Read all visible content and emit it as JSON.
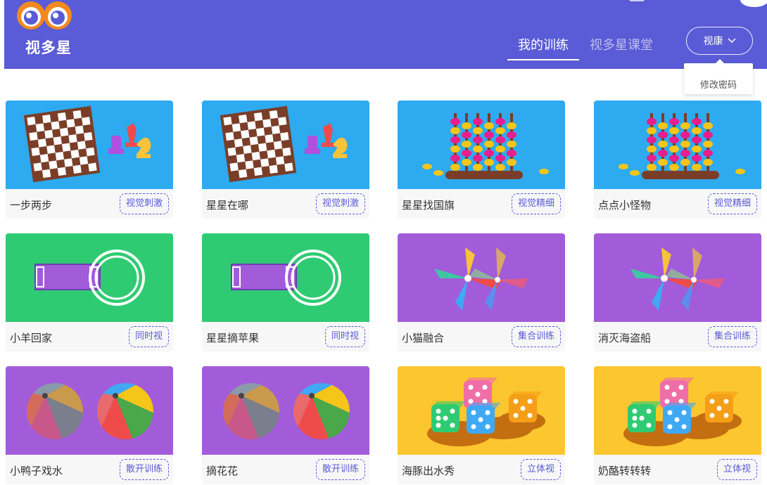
{
  "brand": {
    "name": "视多星",
    "color": "#5a5bd6"
  },
  "nav": {
    "tabs": [
      {
        "label": "我的训练",
        "active": true
      },
      {
        "label": "视多星课堂",
        "active": false
      }
    ]
  },
  "user": {
    "name": "视康",
    "menu": [
      "修改密码"
    ]
  },
  "icons": {
    "user_menu": "chevron-down-icon"
  },
  "cards": [
    {
      "title": "一步两步",
      "tag": "视觉刺激",
      "theme": "chess",
      "bg": "#2eaaf0"
    },
    {
      "title": "星星在哪",
      "tag": "视觉刺激",
      "theme": "chess",
      "bg": "#2eaaf0"
    },
    {
      "title": "星星找国旗",
      "tag": "视觉精细",
      "theme": "abacus",
      "bg": "#2eaaf0"
    },
    {
      "title": "点点小怪物",
      "tag": "视觉精细",
      "theme": "abacus",
      "bg": "#2eaaf0"
    },
    {
      "title": "小羊回家",
      "tag": "同时视",
      "theme": "tube",
      "bg": "#2fcb72"
    },
    {
      "title": "星星摘苹果",
      "tag": "同时视",
      "theme": "tube",
      "bg": "#2fcb72"
    },
    {
      "title": "小猫融合",
      "tag": "集合训练",
      "theme": "pinwheel",
      "bg": "#a25cd9"
    },
    {
      "title": "消灭海盗船",
      "tag": "集合训练",
      "theme": "pinwheel",
      "bg": "#a25cd9"
    },
    {
      "title": "小鸭子戏水",
      "tag": "散开训练",
      "theme": "balls",
      "bg": "#a25cd9"
    },
    {
      "title": "摘花花",
      "tag": "散开训练",
      "theme": "balls",
      "bg": "#a25cd9"
    },
    {
      "title": "海豚出水秀",
      "tag": "立体视",
      "theme": "dice",
      "bg": "#fcc62e"
    },
    {
      "title": "奶酪转转转",
      "tag": "立体视",
      "theme": "dice",
      "bg": "#fcc62e"
    }
  ]
}
